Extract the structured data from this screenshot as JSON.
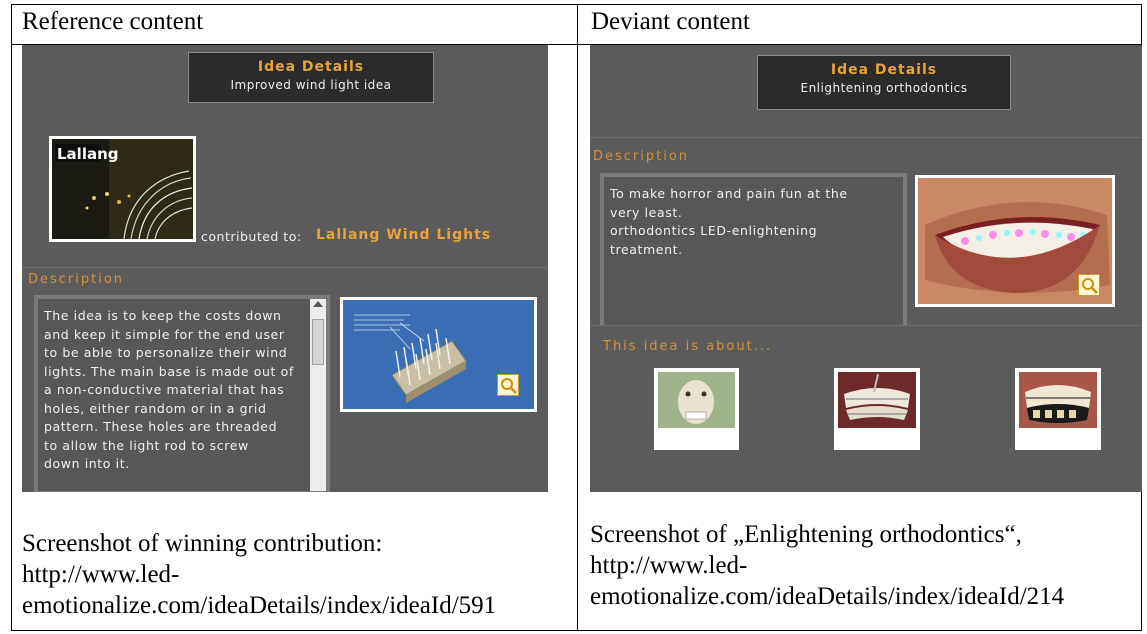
{
  "table": {
    "left_header": "Reference content",
    "right_header": "Deviant content"
  },
  "left": {
    "idea_title": "Idea Details",
    "idea_subtitle": "Improved wind light idea",
    "logo_text": "Lallang",
    "contributed_label": "contributed to:",
    "contributed_target": "Lallang Wind Lights",
    "description_label": "Description",
    "description_lines": [
      "The idea is to keep the costs down",
      "and keep it simple for the end user",
      "to be able to personalize their wind",
      "lights. The main base is made out of",
      "a non-conductive material that has",
      "holes, either random or in a grid",
      "pattern. These holes are threaded",
      "to allow the light rod to screw",
      "down into it."
    ],
    "caption_lines": [
      "Screenshot of winning contribution:",
      "http://www.led-",
      "emotionalize.com/ideaDetails/index/ideaId/591"
    ]
  },
  "right": {
    "idea_title": "Idea Details",
    "idea_subtitle": "Enlightening orthodontics",
    "description_label": "Description",
    "description_lines": [
      "To make horror and pain fun at the",
      "very least.",
      "orthodontics LED-enlightening",
      "treatment."
    ],
    "about_label": "This idea is about...",
    "caption_lines": [
      "Screenshot of „Enlightening orthodontics“,",
      "http://www.led-",
      "emotionalize.com/ideaDetails/index/ideaId/214"
    ]
  },
  "colors": {
    "panel_bg": "#5b5b5b",
    "title_bg": "#2b2b2b",
    "accent_orange": "#e8a33a",
    "text_light": "#f0f0f0"
  },
  "icons": [
    "zoom-icon",
    "scrollbar"
  ]
}
